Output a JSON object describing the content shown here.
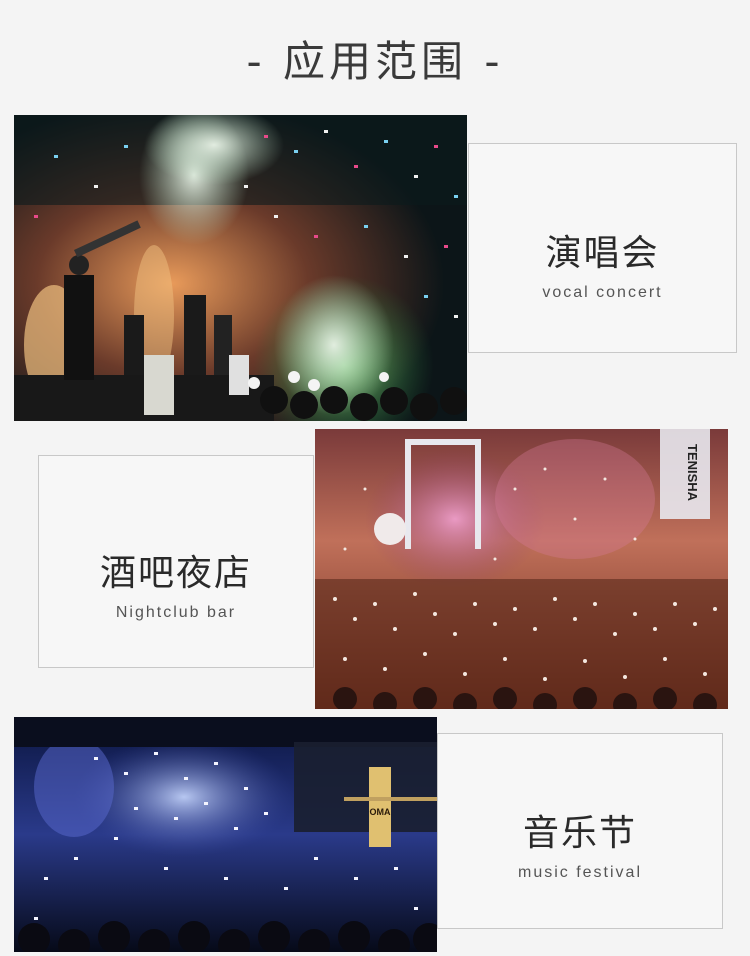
{
  "page": {
    "heading": "- 应用范围 -"
  },
  "sections": [
    {
      "title_zh": "演唱会",
      "title_en": "vocal concert",
      "photo": "concert-stage-photo"
    },
    {
      "title_zh": "酒吧夜店",
      "title_en": "Nightclub bar",
      "photo": "nightclub-crowd-photo"
    },
    {
      "title_zh": "音乐节",
      "title_en": "music festival",
      "photo": "music-festival-photo"
    }
  ],
  "photo_signage": {
    "nightclub_banner": "TENISHA",
    "festival_sign": "OMA"
  }
}
